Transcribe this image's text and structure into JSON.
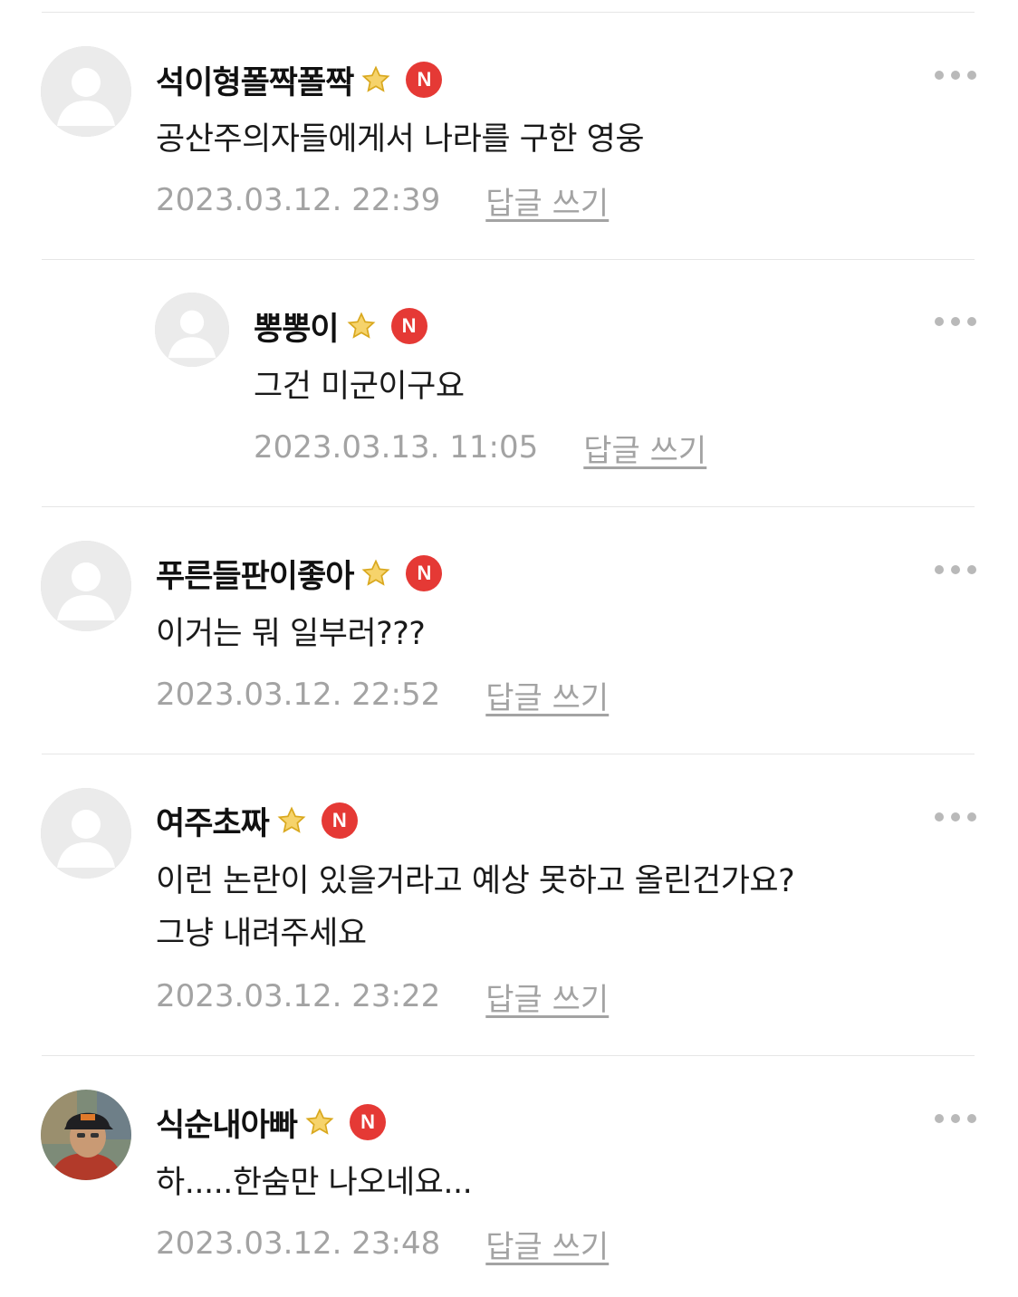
{
  "colors": {
    "badge_red": "#e53935",
    "star_yellow": "#f4c542",
    "meta_gray": "#a3a3a3",
    "divider": "#e6e6e6"
  },
  "comments": [
    {
      "nickname": "석이형폴짝폴짝",
      "badge": "N",
      "text_lines": [
        "공산주의자들에게서 나라를 구한 영웅"
      ],
      "timestamp": "2023.03.12. 22:39",
      "reply_label": "답글 쓰기",
      "avatar": "default-avatar-icon",
      "is_reply": false
    },
    {
      "nickname": "뽕뽕이",
      "badge": "N",
      "text_lines": [
        "그건 미군이구요"
      ],
      "timestamp": "2023.03.13. 11:05",
      "reply_label": "답글 쓰기",
      "avatar": "default-avatar-icon",
      "is_reply": true
    },
    {
      "nickname": "푸른들판이좋아",
      "badge": "N",
      "text_lines": [
        "이거는 뭐 일부러???"
      ],
      "timestamp": "2023.03.12. 22:52",
      "reply_label": "답글 쓰기",
      "avatar": "default-avatar-icon",
      "is_reply": false
    },
    {
      "nickname": "여주초짜",
      "badge": "N",
      "text_lines": [
        "이런 논란이 있을거라고 예상 못하고 올린건가요?",
        "그냥 내려주세요"
      ],
      "timestamp": "2023.03.12. 23:22",
      "reply_label": "답글 쓰기",
      "avatar": "default-avatar-icon",
      "is_reply": false
    },
    {
      "nickname": "식순내아빠",
      "badge": "N",
      "text_lines": [
        "하.....한숨만 나오네요..."
      ],
      "timestamp": "2023.03.12. 23:48",
      "reply_label": "답글 쓰기",
      "avatar": "profile-photo",
      "is_reply": false
    }
  ]
}
